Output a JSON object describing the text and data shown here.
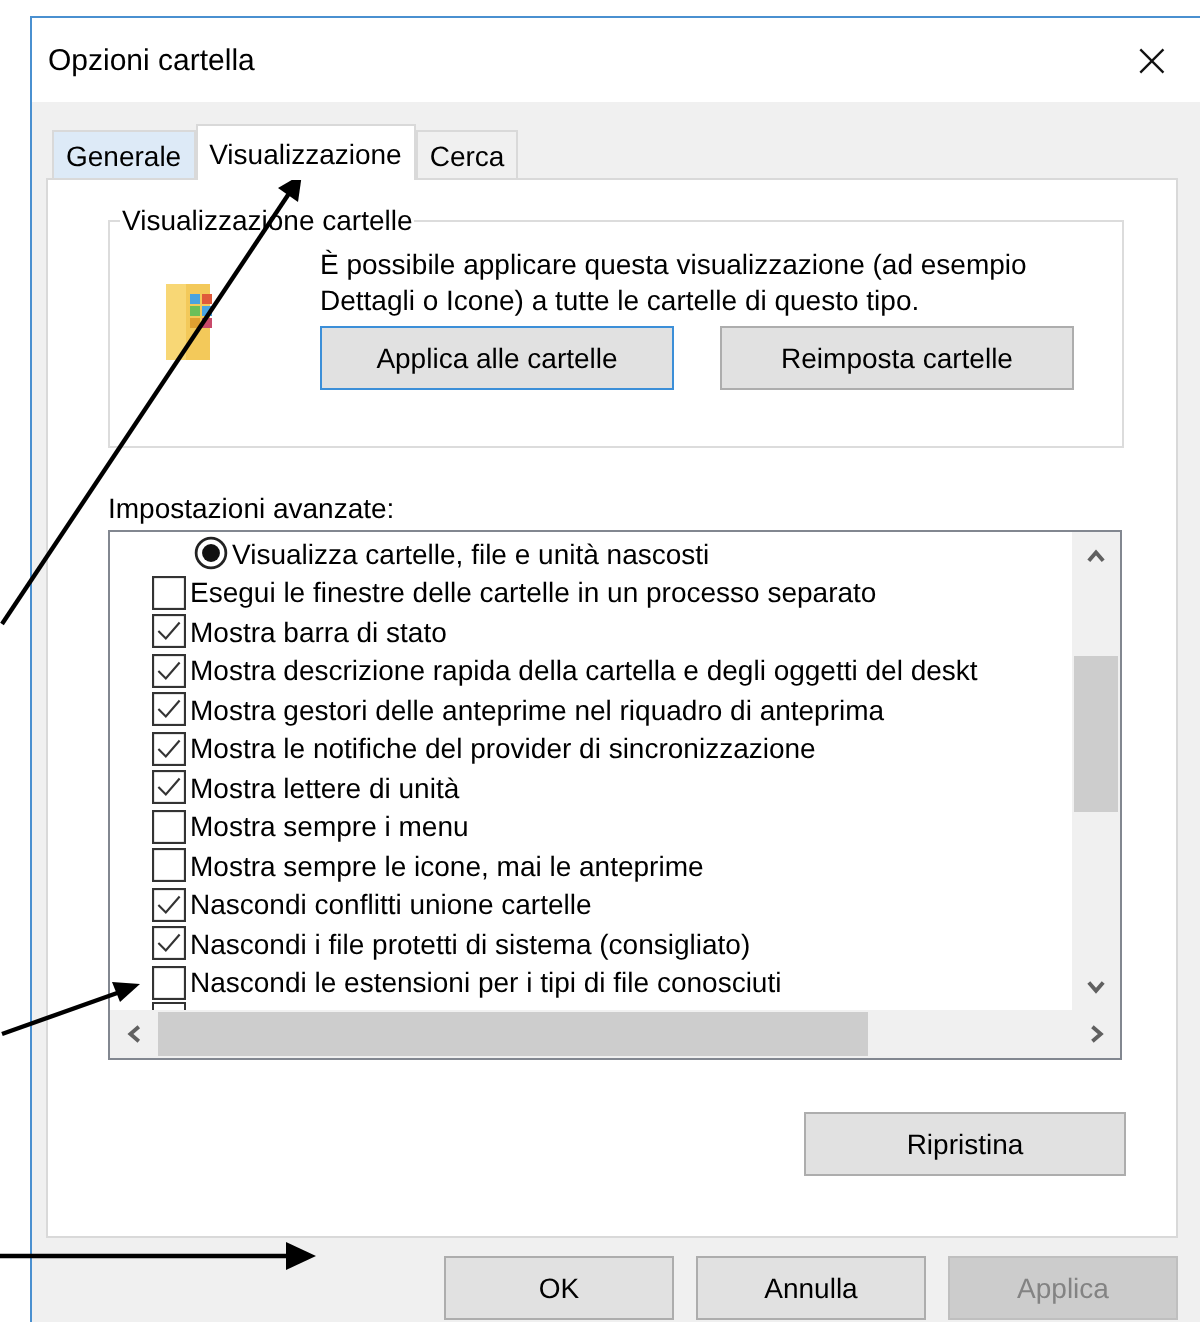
{
  "window": {
    "title": "Opzioni cartella",
    "close": "×"
  },
  "tabs": [
    {
      "label": "Generale",
      "selected": false
    },
    {
      "label": "Visualizzazione",
      "selected": true
    },
    {
      "label": "Cerca",
      "selected": false
    }
  ],
  "folder_views": {
    "title": "Visualizzazione cartelle",
    "description": "È possibile applicare questa visualizzazione (ad esempio Dettagli o Icone) a tutte le cartelle di questo tipo.",
    "buttons": [
      {
        "label": "Applica alle cartelle",
        "focused": true
      },
      {
        "label": "Reimposta cartelle",
        "focused": false
      }
    ]
  },
  "advanced": {
    "label": "Impostazioni avanzate:",
    "items": [
      {
        "kind": "radio",
        "label": "Visualizza cartelle, file e unità nascosti",
        "checked": true
      },
      {
        "kind": "checkbox",
        "label": "Esegui le finestre delle cartelle in un processo separato",
        "checked": false
      },
      {
        "kind": "checkbox",
        "label": "Mostra barra di stato",
        "checked": true
      },
      {
        "kind": "checkbox",
        "label": "Mostra descrizione rapida della cartella e degli oggetti del deskt",
        "checked": true
      },
      {
        "kind": "checkbox",
        "label": "Mostra gestori delle anteprime nel riquadro di anteprima",
        "checked": true
      },
      {
        "kind": "checkbox",
        "label": "Mostra le notifiche del provider di sincronizzazione",
        "checked": true
      },
      {
        "kind": "checkbox",
        "label": "Mostra lettere di unità",
        "checked": true
      },
      {
        "kind": "checkbox",
        "label": "Mostra sempre i menu",
        "checked": false
      },
      {
        "kind": "checkbox",
        "label": "Mostra sempre le icone, mai le anteprime",
        "checked": false
      },
      {
        "kind": "checkbox",
        "label": "Nascondi conflitti unione cartelle",
        "checked": true
      },
      {
        "kind": "checkbox",
        "label": "Nascondi i file protetti di sistema (consigliato)",
        "checked": true
      },
      {
        "kind": "checkbox",
        "label": "Nascondi le estensioni per i tipi di file conosciuti",
        "checked": false
      }
    ],
    "restore": "Ripristina"
  },
  "buttons": [
    {
      "label": "OK",
      "disabled": false
    },
    {
      "label": "Annulla",
      "disabled": false
    },
    {
      "label": "Applica",
      "disabled": true
    }
  ]
}
